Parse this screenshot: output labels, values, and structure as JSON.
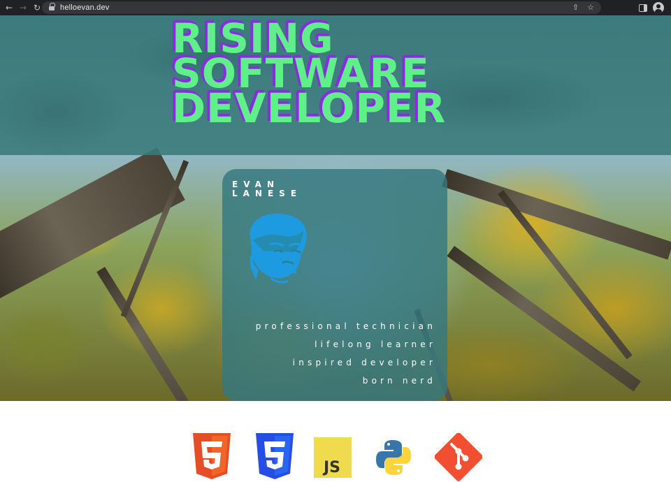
{
  "browser": {
    "url": "helloevan.dev",
    "back_icon": "arrow-left-icon",
    "forward_icon": "arrow-right-icon",
    "reload_icon": "reload-icon",
    "share_icon": "share-icon",
    "bookmark_icon": "star-icon"
  },
  "hero": {
    "headline": [
      "RISING",
      "SOFTWARE",
      "DEVELOPER"
    ],
    "headline_color": "#5ff08a",
    "headline_shadow_color": "#8a2be2",
    "band_color": "#3a7a7a"
  },
  "card": {
    "name_first": "EVAN",
    "name_last": "LANESE",
    "portrait_color": "#1e9be0",
    "taglines": [
      "professional technician",
      "lifelong learner",
      "inspired developer",
      "born nerd"
    ]
  },
  "tech": {
    "icons": [
      "html5-icon",
      "css3-icon",
      "javascript-icon",
      "python-icon",
      "git-icon"
    ],
    "js_label": "JS",
    "html_color": "#e44d26",
    "css_color": "#264de4",
    "js_color": "#f0db4f",
    "git_color": "#f14e32"
  }
}
